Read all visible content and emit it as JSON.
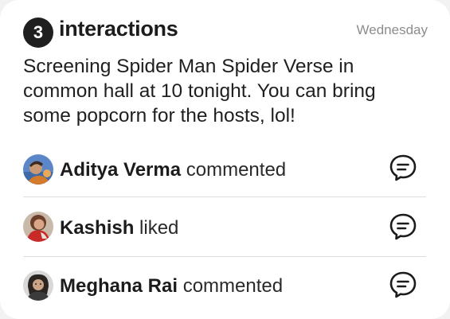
{
  "header": {
    "count": "3",
    "title": "interactions",
    "day": "Wednesday"
  },
  "message": "Screening Spider Man Spider Verse in common hall at 10 tonight. You can bring some popcorn for the hosts, lol!",
  "interactions": [
    {
      "name": "Aditya Verma",
      "action": "commented",
      "icon": "chat-bubble-icon"
    },
    {
      "name": "Kashish",
      "action": "liked",
      "icon": "chat-bubble-icon"
    },
    {
      "name": "Meghana Rai",
      "action": "commented",
      "icon": "chat-bubble-icon"
    }
  ],
  "colors": {
    "badge": "#1f1f1f",
    "muted": "#8c8c8c",
    "divider": "#dedede"
  }
}
